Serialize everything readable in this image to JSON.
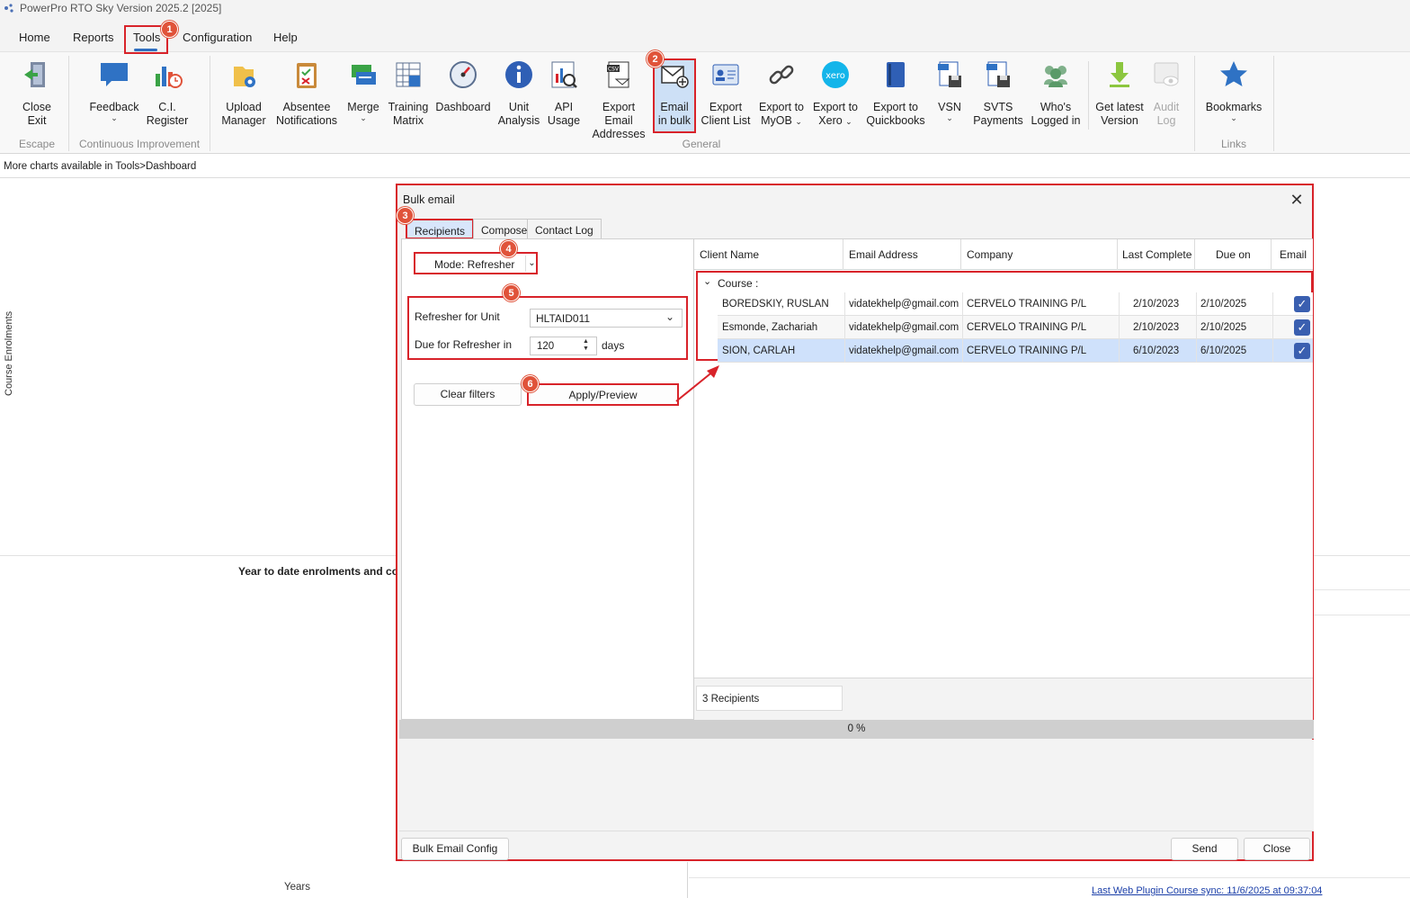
{
  "window": {
    "title": "PowerPro RTO Sky Version 2025.2 [2025]"
  },
  "menu": {
    "items": [
      "Home",
      "Reports",
      "Tools",
      "Configuration",
      "Help"
    ],
    "active": "Tools"
  },
  "ribbon": {
    "escape": {
      "close_exit_l1": "Close",
      "close_exit_l2": "Exit",
      "group_label": "Escape"
    },
    "ci": {
      "feedback": "Feedback",
      "ci_l1": "C.I.",
      "ci_l2": "Register",
      "group_label": "Continuous Improvement"
    },
    "general": {
      "upload_l1": "Upload",
      "upload_l2": "Manager",
      "absentee_l1": "Absentee",
      "absentee_l2": "Notifications",
      "merge": "Merge",
      "training_l1": "Training",
      "training_l2": "Matrix",
      "dashboard": "Dashboard",
      "unit_l1": "Unit",
      "unit_l2": "Analysis",
      "api_l1": "API",
      "api_l2": "Usage",
      "export_email_l1": "Export Email",
      "export_email_l2": "Addresses",
      "email_bulk_l1": "Email",
      "email_bulk_l2": "in bulk",
      "export_client_l1": "Export",
      "export_client_l2": "Client List",
      "export_myob_l1": "Export to",
      "export_myob_l2": "MyOB",
      "export_xero_l1": "Export to",
      "export_xero_l2": "Xero",
      "export_qb_l1": "Export to",
      "export_qb_l2": "Quickbooks",
      "vsn": "VSN",
      "svts_l1": "SVTS",
      "svts_l2": "Payments",
      "whos_l1": "Who's",
      "whos_l2": "Logged in",
      "latest_l1": "Get latest",
      "latest_l2": "Version",
      "audit_l1": "Audit",
      "audit_l2": "Log",
      "group_label": "General",
      "xero_logo": "xero",
      "csv_badge": "CSV"
    },
    "links": {
      "bookmarks": "Bookmarks",
      "group_label": "Links"
    }
  },
  "info_text": "More charts available in Tools>Dashboard",
  "background": {
    "y_axis_label": "Course Enrolments",
    "chart2_title": "Year to date enrolments and co",
    "x_axis_label": "Years",
    "sync_link": "Last Web Plugin Course sync: 11/6/2025 at 09:37:04"
  },
  "dialog": {
    "title": "Bulk email",
    "close_glyph": "✕",
    "tabs": [
      "Recipients",
      "Compose",
      "Contact Log"
    ],
    "mode": "Mode: Refresher",
    "refresher_unit_label": "Refresher for Unit",
    "refresher_unit_value": "HLTAID011",
    "due_label": "Due for Refresher in",
    "due_value": "120",
    "due_unit": "days",
    "clear_filters": "Clear filters",
    "apply_preview": "Apply/Preview",
    "grid": {
      "columns": [
        "Client Name",
        "Email Address",
        "Company",
        "Last Completed",
        "Due on",
        "Email"
      ],
      "group_label": "Course :",
      "rows": [
        {
          "name": "BOREDSKIY, RUSLAN",
          "email": "vidatekhelp@gmail.com",
          "company": "CERVELO TRAINING P/L",
          "last": "2/10/2023",
          "due": "2/10/2025",
          "checked": true
        },
        {
          "name": "Esmonde, Zachariah",
          "email": "vidatekhelp@gmail.com",
          "company": "CERVELO TRAINING P/L",
          "last": "2/10/2023",
          "due": "2/10/2025",
          "checked": true
        },
        {
          "name": "SION, CARLAH",
          "email": "vidatekhelp@gmail.com",
          "company": "CERVELO TRAINING P/L",
          "last": "6/10/2023",
          "due": "6/10/2025",
          "checked": true
        }
      ]
    },
    "recipients_count": "3 Recipients",
    "progress": "0 %",
    "bulk_email_config": "Bulk Email Config",
    "send": "Send",
    "close": "Close"
  },
  "callouts": [
    "1",
    "2",
    "3",
    "4",
    "5",
    "6"
  ],
  "colors": {
    "highlight": "#d8232a",
    "badge": "#e0533a",
    "selected_row": "#cfe1fb",
    "checkbox": "#3a5fb0"
  }
}
